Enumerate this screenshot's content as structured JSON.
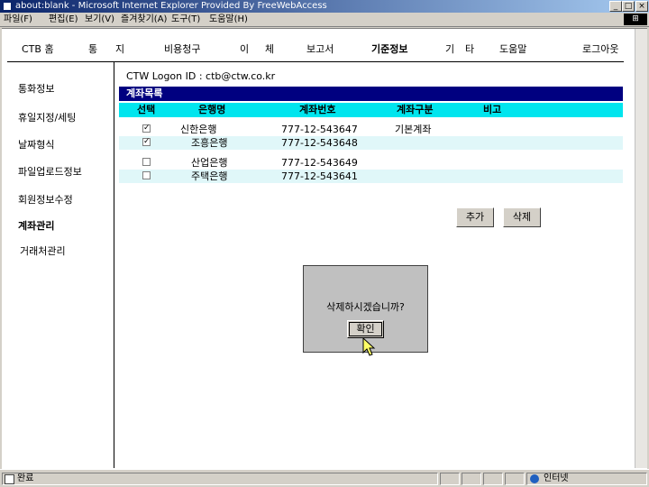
{
  "window": {
    "title": "about:blank - Microsoft Internet Explorer Provided By FreeWebAccess",
    "controls": [
      "_",
      "□",
      "×"
    ]
  },
  "menubar": {
    "items": [
      "파일(F)",
      "편집(E)",
      "보기(V)",
      "즐겨찾기(A)",
      "도구(T)",
      "도움말(H)"
    ]
  },
  "topnav": {
    "items": [
      "CTB 홈",
      "통",
      "지",
      "비용청구",
      "이",
      "체",
      "보고서",
      "기준정보",
      "기",
      "타",
      "도움말",
      "로그아웃"
    ]
  },
  "sidebar": {
    "items": [
      "통화정보",
      "휴일지정/세팅",
      "날짜형식",
      "파일업로드정보",
      "회원정보수정",
      "계좌관리",
      "거래처관리"
    ]
  },
  "logon": "CTW Logon ID : ctb@ctw.co.kr",
  "account_list": {
    "title": "계좌목록",
    "columns": [
      "선택",
      "은행명",
      "계좌번호",
      "계좌구분",
      "비고"
    ],
    "rows": [
      {
        "checked": true,
        "bank": "신한은행",
        "account": "777-12-543647",
        "type": "기본계좌",
        "note": ""
      },
      {
        "checked": true,
        "bank": "조흥은행",
        "account": "777-12-543648",
        "type": "",
        "note": ""
      },
      {
        "checked": false,
        "bank": "산업은행",
        "account": "777-12-543649",
        "type": "",
        "note": ""
      },
      {
        "checked": false,
        "bank": "주택은행",
        "account": "777-12-543641",
        "type": "",
        "note": ""
      }
    ],
    "check_mark": "✓"
  },
  "buttons": {
    "add": "추가",
    "delete": "삭제"
  },
  "dialog": {
    "message": "삭제하시겠습니까?",
    "confirm": "확인"
  },
  "statusbar": {
    "left": "완료",
    "zone": "인터넷"
  }
}
